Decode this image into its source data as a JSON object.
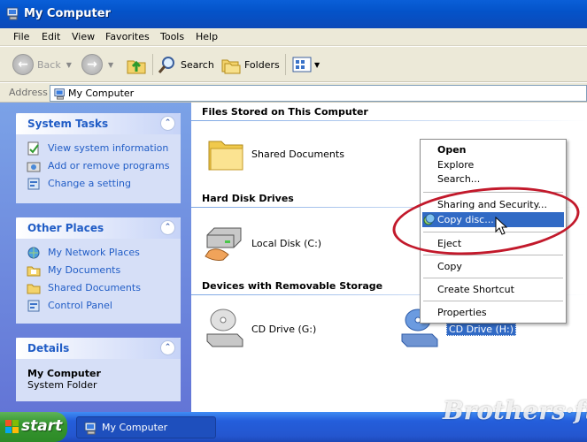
{
  "window": {
    "title": "My Computer"
  },
  "menu": [
    "File",
    "Edit",
    "View",
    "Favorites",
    "Tools",
    "Help"
  ],
  "toolbar": {
    "back": "Back",
    "search": "Search",
    "folders": "Folders"
  },
  "address": {
    "label": "Address",
    "value": "My Computer"
  },
  "system_tasks": {
    "title": "System Tasks",
    "items": [
      "View system information",
      "Add or remove programs",
      "Change a setting"
    ]
  },
  "other_places": {
    "title": "Other Places",
    "items": [
      "My Network Places",
      "My Documents",
      "Shared Documents",
      "Control Panel"
    ]
  },
  "details": {
    "title": "Details",
    "name": "My Computer",
    "type": "System Folder"
  },
  "groups": {
    "files": {
      "header": "Files Stored on This Computer",
      "items": [
        "Shared Documents"
      ]
    },
    "hdd": {
      "header": "Hard Disk Drives",
      "items": [
        "Local Disk (C:)"
      ]
    },
    "removable": {
      "header": "Devices with Removable Storage",
      "items": [
        "CD Drive (G:)",
        "CD Drive (H:)"
      ]
    }
  },
  "context_menu": {
    "open": "Open",
    "explore": "Explore",
    "search": "Search...",
    "sharing": "Sharing and Security...",
    "copy_disc": "Copy disc...",
    "eject": "Eject",
    "copy": "Copy",
    "create_shortcut": "Create Shortcut",
    "properties": "Properties"
  },
  "taskbar": {
    "start": "start",
    "task": "My Computer"
  },
  "watermark": "Brothers·ft",
  "colors": {
    "accent": "#316ac5",
    "annotation": "#c2192b",
    "link": "#215dc6"
  }
}
